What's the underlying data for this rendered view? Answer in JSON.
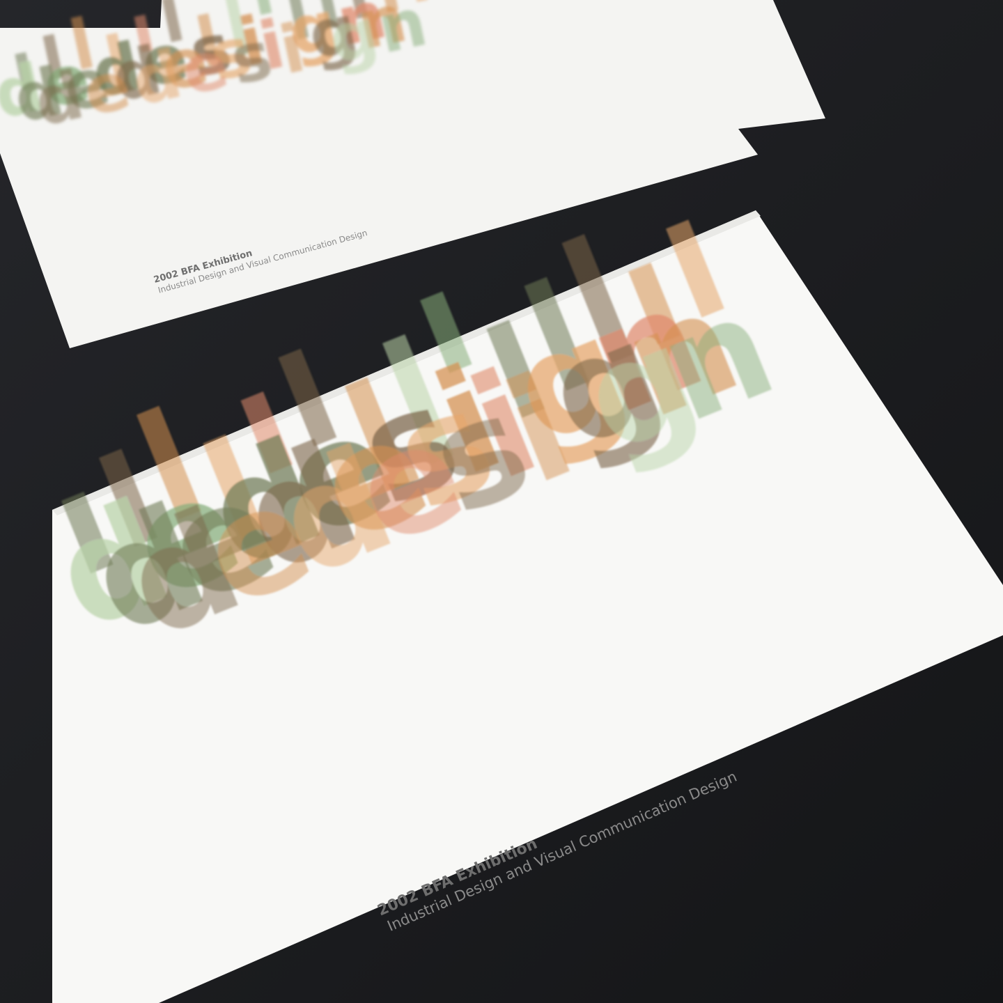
{
  "scene": {
    "background_color": "#1b1c1e",
    "card_color": "#f7f7f5",
    "palette": {
      "green_light": "#b9d3a8",
      "green": "#86ad7a",
      "olive": "#6f7a55",
      "brown": "#7b6548",
      "orange": "#d48f4f",
      "orange_light": "#e6a66a",
      "salmon": "#e08a6c"
    }
  },
  "cards": [
    {
      "id": "back-card",
      "wordmark": [
        "d",
        "e",
        "d",
        "e",
        "s",
        "i",
        "g",
        "n"
      ],
      "caption_title": "2002 BFA Exhibition",
      "caption_subtitle": "Industrial Design and Visual Communication Design"
    },
    {
      "id": "front-card",
      "wordmark": [
        "d",
        "e",
        "d",
        "e",
        "s",
        "i",
        "g",
        "n"
      ],
      "caption_title": "2002 BFA Exhibition",
      "caption_subtitle": "Industrial Design and Visual Communication Design"
    }
  ]
}
